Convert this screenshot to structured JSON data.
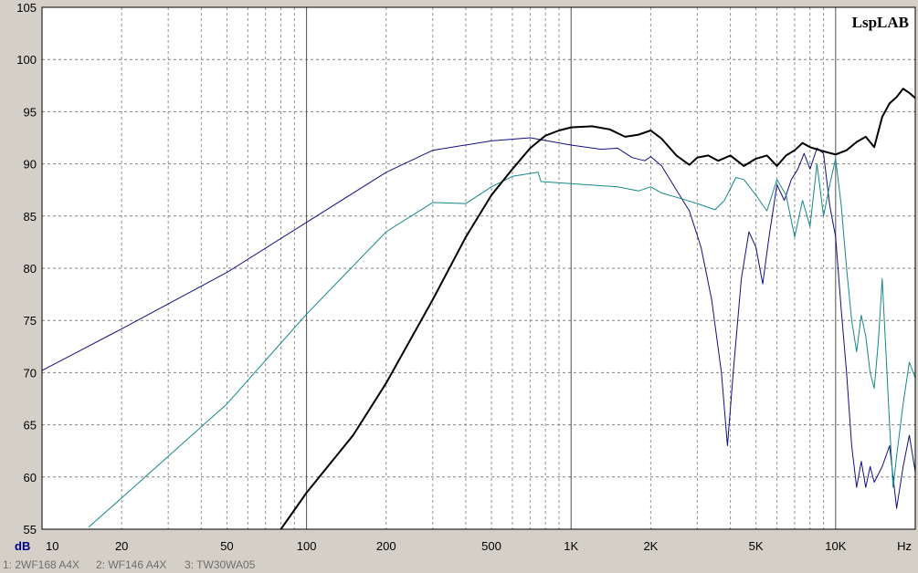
{
  "chart_data": {
    "type": "line",
    "title": "",
    "brand": "LspLAB",
    "xlabel": "Hz",
    "ylabel": "dB",
    "x_scale": "log",
    "xlim": [
      10,
      20000
    ],
    "ylim": [
      55,
      105
    ],
    "grid": true,
    "y_ticks": [
      55,
      60,
      65,
      70,
      75,
      80,
      85,
      90,
      95,
      100,
      105
    ],
    "x_ticks": [
      {
        "value": 10,
        "label": "10"
      },
      {
        "value": 20,
        "label": "20"
      },
      {
        "value": 50,
        "label": "50"
      },
      {
        "value": 100,
        "label": "100"
      },
      {
        "value": 200,
        "label": "200"
      },
      {
        "value": 500,
        "label": "500"
      },
      {
        "value": 1000,
        "label": "1K"
      },
      {
        "value": 2000,
        "label": "2K"
      },
      {
        "value": 5000,
        "label": "5K"
      },
      {
        "value": 10000,
        "label": "10K"
      },
      {
        "value": 20000,
        "label": "Hz"
      }
    ],
    "series": [
      {
        "name": "1: 2WF168 A4X",
        "color": "#101080",
        "points": [
          [
            10,
            70.2
          ],
          [
            20,
            74.2
          ],
          [
            50,
            79.6
          ],
          [
            100,
            84.4
          ],
          [
            200,
            89.2
          ],
          [
            300,
            91.3
          ],
          [
            500,
            92.2
          ],
          [
            700,
            92.5
          ],
          [
            1000,
            91.8
          ],
          [
            1300,
            91.4
          ],
          [
            1500,
            91.5
          ],
          [
            1700,
            90.6
          ],
          [
            1900,
            90.3
          ],
          [
            2000,
            90.7
          ],
          [
            2200,
            89.8
          ],
          [
            2500,
            87.5
          ],
          [
            2800,
            85.5
          ],
          [
            3100,
            82.0
          ],
          [
            3400,
            77.0
          ],
          [
            3700,
            70.0
          ],
          [
            3900,
            63.0
          ],
          [
            4100,
            70.0
          ],
          [
            4400,
            79.0
          ],
          [
            4700,
            83.5
          ],
          [
            5000,
            82.0
          ],
          [
            5300,
            78.5
          ],
          [
            5600,
            83.0
          ],
          [
            6000,
            88.0
          ],
          [
            6400,
            86.5
          ],
          [
            6800,
            88.5
          ],
          [
            7200,
            89.5
          ],
          [
            7600,
            91.0
          ],
          [
            8000,
            89.5
          ],
          [
            8500,
            91.5
          ],
          [
            9000,
            91.0
          ],
          [
            9500,
            86.0
          ],
          [
            10000,
            83.0
          ],
          [
            10500,
            76.0
          ],
          [
            11000,
            70.0
          ],
          [
            11500,
            63.0
          ],
          [
            12000,
            59.0
          ],
          [
            12500,
            61.5
          ],
          [
            13000,
            59.0
          ],
          [
            13500,
            61.0
          ],
          [
            14000,
            59.5
          ],
          [
            15000,
            61.0
          ],
          [
            16000,
            63.0
          ],
          [
            17000,
            57.0
          ],
          [
            18000,
            61.0
          ],
          [
            19000,
            64.0
          ],
          [
            20000,
            60.5
          ]
        ]
      },
      {
        "name": "2: WF146 A4X",
        "color": "#168888",
        "points": [
          [
            15,
            55.2
          ],
          [
            20,
            58.0
          ],
          [
            50,
            67.0
          ],
          [
            100,
            75.6
          ],
          [
            200,
            83.5
          ],
          [
            300,
            86.3
          ],
          [
            400,
            86.2
          ],
          [
            500,
            87.8
          ],
          [
            600,
            88.8
          ],
          [
            750,
            89.2
          ],
          [
            770,
            88.3
          ],
          [
            1000,
            88.1
          ],
          [
            1500,
            87.8
          ],
          [
            1800,
            87.4
          ],
          [
            2000,
            87.8
          ],
          [
            2200,
            87.2
          ],
          [
            2500,
            86.8
          ],
          [
            3000,
            86.2
          ],
          [
            3500,
            85.6
          ],
          [
            3800,
            86.5
          ],
          [
            4200,
            88.7
          ],
          [
            4500,
            88.5
          ],
          [
            5000,
            87.0
          ],
          [
            5500,
            85.5
          ],
          [
            6000,
            88.5
          ],
          [
            6500,
            87.0
          ],
          [
            7000,
            83.0
          ],
          [
            7500,
            86.5
          ],
          [
            8000,
            84.0
          ],
          [
            8500,
            90.0
          ],
          [
            9000,
            85.0
          ],
          [
            9500,
            88.0
          ],
          [
            10000,
            90.5
          ],
          [
            10500,
            86.0
          ],
          [
            11000,
            80.0
          ],
          [
            11500,
            75.0
          ],
          [
            12000,
            72.0
          ],
          [
            12500,
            75.5
          ],
          [
            13000,
            73.5
          ],
          [
            13500,
            70.0
          ],
          [
            14000,
            68.5
          ],
          [
            14500,
            73.0
          ],
          [
            15000,
            79.0
          ],
          [
            15500,
            72.0
          ],
          [
            16000,
            65.0
          ],
          [
            16500,
            59.0
          ],
          [
            17000,
            62.0
          ],
          [
            18000,
            67.0
          ],
          [
            19000,
            71.0
          ],
          [
            20000,
            69.5
          ]
        ]
      },
      {
        "name": "3: TW30WA05",
        "color": "#000000",
        "points": [
          [
            80,
            55.0
          ],
          [
            100,
            58.5
          ],
          [
            150,
            64.0
          ],
          [
            200,
            69.0
          ],
          [
            300,
            77.0
          ],
          [
            400,
            83.0
          ],
          [
            500,
            87.0
          ],
          [
            600,
            89.5
          ],
          [
            700,
            91.5
          ],
          [
            800,
            92.7
          ],
          [
            900,
            93.2
          ],
          [
            1000,
            93.5
          ],
          [
            1200,
            93.6
          ],
          [
            1400,
            93.3
          ],
          [
            1600,
            92.6
          ],
          [
            1800,
            92.8
          ],
          [
            2000,
            93.2
          ],
          [
            2200,
            92.4
          ],
          [
            2500,
            90.8
          ],
          [
            2800,
            89.9
          ],
          [
            3000,
            90.6
          ],
          [
            3300,
            90.8
          ],
          [
            3600,
            90.3
          ],
          [
            4000,
            90.8
          ],
          [
            4500,
            89.8
          ],
          [
            5000,
            90.5
          ],
          [
            5500,
            90.8
          ],
          [
            6000,
            89.8
          ],
          [
            6500,
            90.8
          ],
          [
            7000,
            91.3
          ],
          [
            7500,
            92.0
          ],
          [
            8000,
            91.6
          ],
          [
            9000,
            91.2
          ],
          [
            10000,
            90.9
          ],
          [
            11000,
            91.3
          ],
          [
            12000,
            92.1
          ],
          [
            13000,
            92.6
          ],
          [
            14000,
            91.6
          ],
          [
            15000,
            94.5
          ],
          [
            16000,
            95.8
          ],
          [
            17000,
            96.4
          ],
          [
            18000,
            97.2
          ],
          [
            19000,
            96.8
          ],
          [
            20000,
            96.3
          ]
        ]
      }
    ],
    "legend": [
      {
        "label": "1: 2WF168 A4X",
        "active": false
      },
      {
        "label": "2: WF146 A4X",
        "active": false
      },
      {
        "label": "3: TW30WA05",
        "active": true
      }
    ]
  }
}
